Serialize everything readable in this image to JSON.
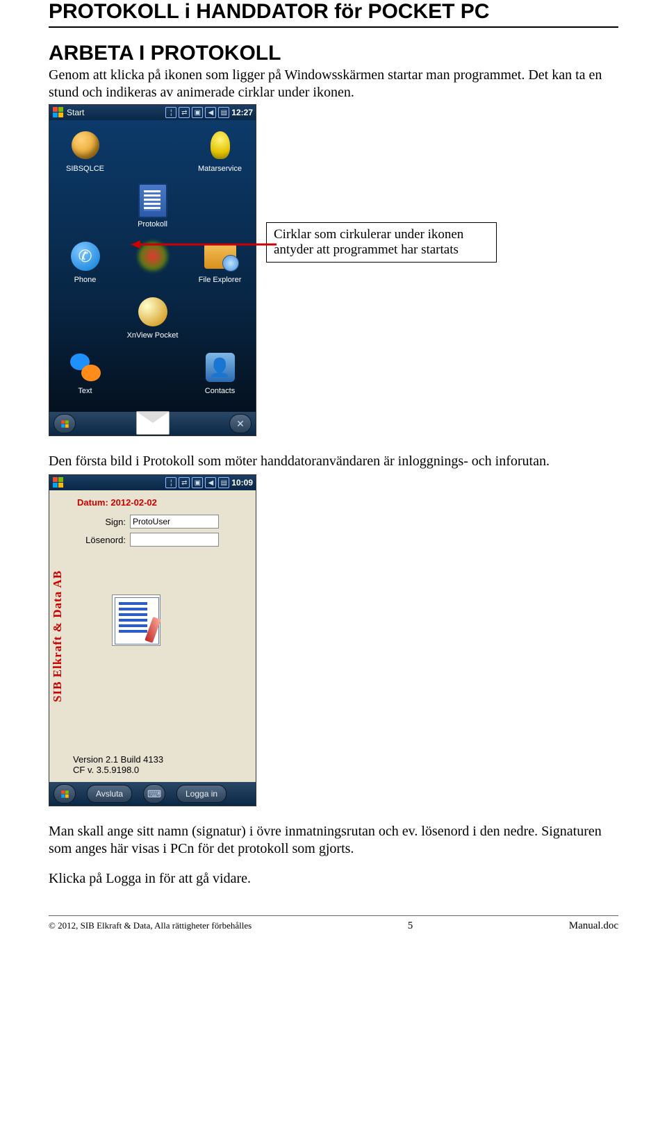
{
  "title": "PROTOKOLL i HANDDATOR för POCKET PC",
  "heading1": "ARBETA I PROTOKOLL",
  "intro": "Genom att klicka på ikonen som ligger på Windowsskärmen startar man programmet. Det kan ta en stund och indikeras av animerade cirklar under ikonen.",
  "callout": "Cirklar som cirkulerar under ikonen antyder att programmet har startats",
  "para2": "Den första bild i Protokoll som möter handdatoranvändaren är inloggnings- och inforutan.",
  "para3a": "Man skall ange sitt namn (signatur) i övre inmatningsrutan och ev. lösenord i den nedre. Signaturen som anges här visas i PCn för det protokoll som gjorts.",
  "para3b": "Klicka på Logga in för att gå vidare.",
  "device1": {
    "start": "Start",
    "clock": "12:27",
    "icons": [
      "SIBSQLCE",
      "Matarservice",
      "Protokoll",
      "Phone",
      "File Explorer",
      "XnView Pocket",
      "Text",
      "Contacts",
      "E-mail"
    ]
  },
  "device2": {
    "clock": "10:09",
    "side": "SIB Elkraft & Data AB",
    "date_label": "Datum: 2012-02-02",
    "sign_label": "Sign:",
    "sign_value": "ProtoUser",
    "pass_label": "Lösenord:",
    "pass_value": "",
    "ver1": "Version 2.1 Build 4133",
    "ver2": "CF v. 3.5.9198.0",
    "btn_left": "Avsluta",
    "btn_right": "Logga in"
  },
  "footer": {
    "copy": "© 2012, SIB Elkraft & Data, Alla rättigheter förbehålles",
    "page": "5",
    "file": "Manual.doc"
  }
}
